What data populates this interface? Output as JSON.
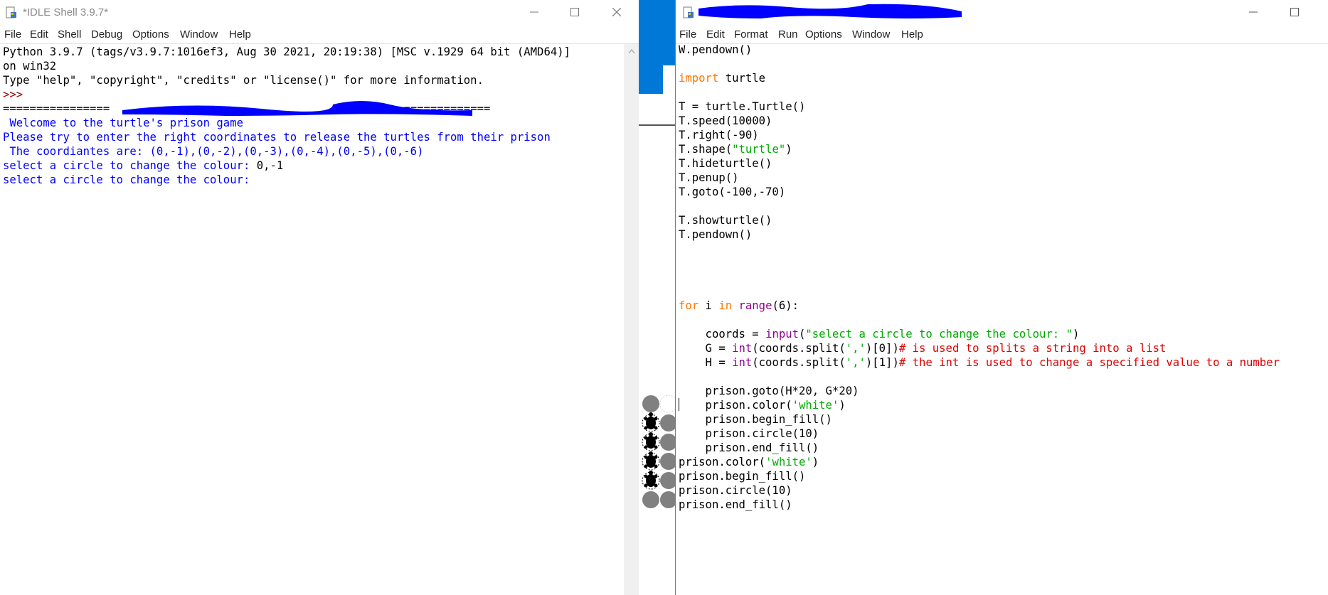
{
  "shell": {
    "title": "*IDLE Shell 3.9.7*",
    "menu": [
      "File",
      "Edit",
      "Shell",
      "Debug",
      "Options",
      "Window",
      "Help"
    ],
    "banner": [
      "Python 3.9.7 (tags/v3.9.7:1016ef3, Aug 30 2021, 20:19:38) [MSC v.1929 64 bit (AMD64)]",
      "on win32",
      "Type \"help\", \"copyright\", \"credits\" or \"license()\" for more information."
    ],
    "prompt": ">>>",
    "restart_left": "================",
    "restart_right": "==============",
    "output": [
      " Welcome to the turtle's prison game",
      "Please try to enter the right coordinates to release the turtles from their prison",
      " The coordiantes are: (0,-1),(0,-2),(0,-3),(0,-4),(0,-5),(0,-6)"
    ],
    "input_prompt": "select a circle to change the colour: ",
    "input_value": "0,-1",
    "current_prompt": "select a circle to change the colour:"
  },
  "editor": {
    "menu": [
      "File",
      "Edit",
      "Format",
      "Run",
      "Options",
      "Window",
      "Help"
    ],
    "code": {
      "l1": "W.pendown()",
      "import_kw": "import",
      "import_mod": " turtle",
      "l3": "T = turtle.Turtle()",
      "l4": "T.speed(10000)",
      "l5": "T.right(-90)",
      "l6a": "T.shape(",
      "l6s": "\"turtle\"",
      "l6b": ")",
      "l7": "T.hideturtle()",
      "l8": "T.penup()",
      "l9": "T.goto(-100,-70)",
      "l10": "T.showturtle()",
      "l11": "T.pendown()",
      "for_kw": "for",
      "for_mid": " i ",
      "in_kw": "in",
      "range_fn": "range",
      "for_end": "(6):",
      "in1a": "    coords = ",
      "in1fn": "input",
      "in1b": "(",
      "in1s": "\"select a circle to change the colour: \"",
      "in1c": ")",
      "g_a": "    G = ",
      "g_fn": "int",
      "g_b": "(coords.split(",
      "g_s": "','",
      "g_c": ")[0])",
      "g_cmt": "# is used to splits a string into a list",
      "h_a": "    H = ",
      "h_fn": "int",
      "h_b": "(coords.split(",
      "h_s": "','",
      "h_c": ")[1])",
      "h_cmt": "# the int is used to change a specified value to a number",
      "p1": "    prison.goto(H*20, G*20)",
      "p2a": "    prison.color(",
      "p2s": "'white'",
      "p2b": ")",
      "p3": "    prison.begin_fill()",
      "p4": "    prison.circle(10)",
      "p5": "    prison.end_fill()",
      "q1a": "prison.color(",
      "q1s": "'white'",
      "q1b": ")",
      "q2": "prison.begin_fill()",
      "q3": "prison.circle(10)",
      "q4": "prison.end_fill()"
    }
  },
  "colors": {
    "output": "#0000ff",
    "prompt": "#a00000",
    "keyword": "#ff7700",
    "builtin": "#900090",
    "string": "#00aa00",
    "comment": "#dd0000",
    "redaction": "#0000ff",
    "turtle_bg": "#0078d7"
  }
}
